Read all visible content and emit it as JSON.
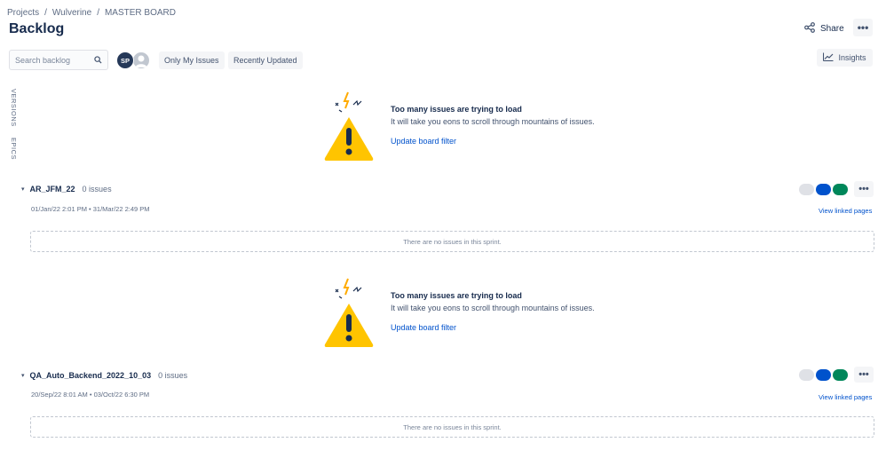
{
  "breadcrumb": [
    "Projects",
    "Wulverine",
    "MASTER BOARD"
  ],
  "page_title": "Backlog",
  "header": {
    "share_label": "Share",
    "more_label": "•••"
  },
  "search": {
    "placeholder": "Search backlog"
  },
  "avatars": [
    {
      "initials": "SP",
      "color": "#253858"
    }
  ],
  "filters": {
    "only_my_issues": "Only My Issues",
    "recently_updated": "Recently Updated"
  },
  "insights_label": "Insights",
  "side_tabs": {
    "versions": "VERSIONS",
    "epics": "EPICS"
  },
  "warning": {
    "title": "Too many issues are trying to load",
    "description": "It will take you eons to scroll through mountains of issues.",
    "link": "Update board filter"
  },
  "sprints": [
    {
      "name": "AR_JFM_22",
      "count": "0 issues",
      "dates": "01/Jan/22 2:01 PM  •  31/Mar/22 2:49 PM",
      "linked": "View linked pages",
      "empty": "There are no issues in this sprint.",
      "more": "•••"
    },
    {
      "name": "QA_Auto_Backend_2022_10_03",
      "count": "0 issues",
      "dates": "20/Sep/22 8:01 AM  •  03/Oct/22 6:30 PM",
      "linked": "View linked pages",
      "empty": "There are no issues in this sprint.",
      "more": "•••"
    }
  ],
  "colors": {
    "status_todo": "#dfe1e6",
    "status_in_progress": "#0052cc",
    "status_done": "#00875a",
    "link": "#0052cc",
    "warning_yellow": "#ffc400"
  }
}
